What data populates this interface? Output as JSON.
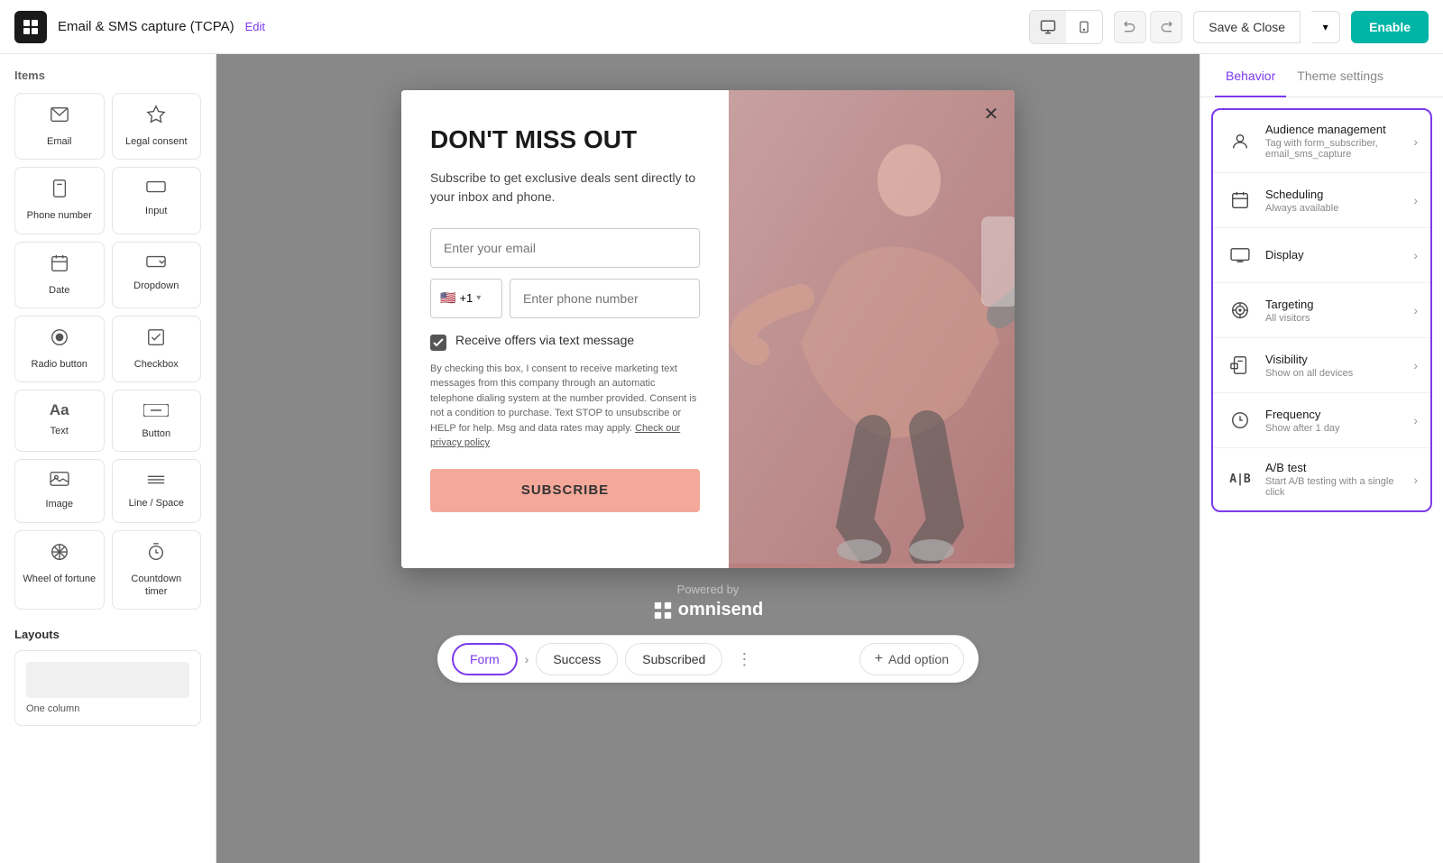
{
  "topbar": {
    "logo": "O",
    "title": "Email & SMS capture (TCPA)",
    "edit_label": "Edit",
    "device_desktop": "🖥",
    "device_mobile": "📱",
    "undo": "↩",
    "redo": "↪",
    "save_close": "Save & Close",
    "enable": "Enable"
  },
  "sidebar": {
    "items_title": "Items",
    "items": [
      {
        "id": "email",
        "icon": "✉",
        "label": "Email"
      },
      {
        "id": "legal",
        "icon": "⚖",
        "label": "Legal consent"
      },
      {
        "id": "phone",
        "icon": "📞",
        "label": "Phone number"
      },
      {
        "id": "input",
        "icon": "▭",
        "label": "Input"
      },
      {
        "id": "date",
        "icon": "📅",
        "label": "Date"
      },
      {
        "id": "dropdown",
        "icon": "▾",
        "label": "Dropdown"
      },
      {
        "id": "radio",
        "icon": "◎",
        "label": "Radio button"
      },
      {
        "id": "checkbox",
        "icon": "☑",
        "label": "Checkbox"
      },
      {
        "id": "text",
        "icon": "Aa",
        "label": "Text"
      },
      {
        "id": "button",
        "icon": "—",
        "label": "Button"
      },
      {
        "id": "image",
        "icon": "🖼",
        "label": "Image"
      },
      {
        "id": "line",
        "icon": "≡",
        "label": "Line / Space"
      },
      {
        "id": "wheel",
        "icon": "⊕",
        "label": "Wheel of fortune"
      },
      {
        "id": "countdown",
        "icon": "⏱",
        "label": "Countdown timer"
      }
    ],
    "layouts_title": "Layouts",
    "layouts": [
      {
        "id": "one-column",
        "label": "One column"
      }
    ]
  },
  "popup": {
    "close_icon": "✕",
    "title": "DON'T MISS OUT",
    "description": "Subscribe to get exclusive deals sent directly to your inbox and phone.",
    "email_placeholder": "Enter your email",
    "flag": "🇺🇸",
    "country_code": "+1",
    "phone_placeholder": "Enter phone number",
    "checkbox_label": "Receive offers via text message",
    "legal_text": "By checking this box, I consent to receive marketing text messages from this company through an automatic telephone dialing system at the number provided. Consent is not a condition to purchase. Text STOP to unsubscribe or HELP for help. Msg and data rates may apply.",
    "privacy_link": "Check our privacy policy",
    "subscribe_btn": "SUBSCRIBE",
    "powered_by": "Powered by",
    "brand": "omnisend"
  },
  "bottom_bar": {
    "form_tab": "Form",
    "arrow": "›",
    "success_tab": "Success",
    "subscribed_tab": "Subscribed",
    "dots": "⋮",
    "add_option": "+ Add option"
  },
  "right_panel": {
    "tabs": [
      {
        "id": "behavior",
        "label": "Behavior"
      },
      {
        "id": "theme",
        "label": "Theme settings"
      }
    ],
    "behavior_items": [
      {
        "id": "audience",
        "icon": "👤",
        "label": "Audience management",
        "sub": "Tag with form_subscriber, email_sms_capture"
      },
      {
        "id": "scheduling",
        "icon": "📅",
        "label": "Scheduling",
        "sub": "Always available"
      },
      {
        "id": "display",
        "icon": "🖥",
        "label": "Display",
        "sub": ""
      },
      {
        "id": "targeting",
        "icon": "🎯",
        "label": "Targeting",
        "sub": "All visitors"
      },
      {
        "id": "visibility",
        "icon": "📱",
        "label": "Visibility",
        "sub": "Show on all devices"
      },
      {
        "id": "frequency",
        "icon": "🕐",
        "label": "Frequency",
        "sub": "Show after 1 day"
      },
      {
        "id": "ab-test",
        "icon": "AB",
        "label": "A/B test",
        "sub": "Start A/B testing with a single click"
      }
    ]
  },
  "colors": {
    "accent": "#7c3aed",
    "teal": "#00b4a6",
    "pink_btn": "#f4a89a"
  }
}
